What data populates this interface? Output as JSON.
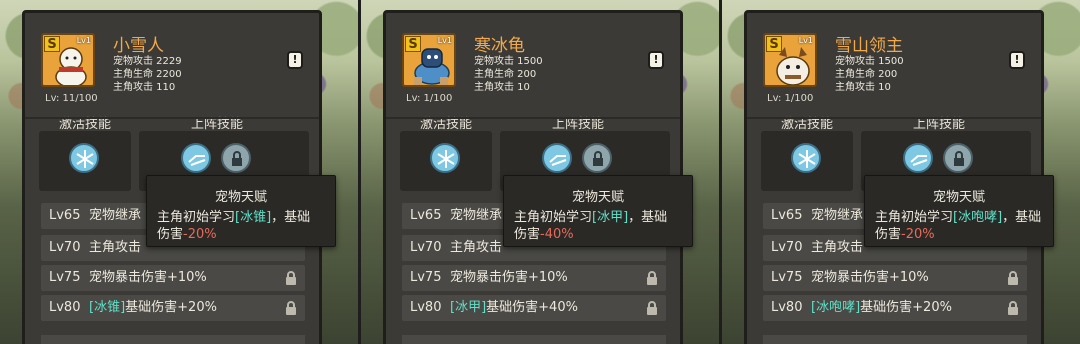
{
  "panels": [
    {
      "name": "小雪人",
      "level_badge": "Lv1",
      "level_line": "Lv: 11/100",
      "grade": "S",
      "stats": [
        "宠物攻击 2229",
        "主角生命 2200",
        "主角攻击 110"
      ],
      "rows": [
        {
          "lv": "Lv65",
          "text": "宠物继承",
          "pre": "",
          "post": ""
        },
        {
          "lv": "Lv70",
          "text": "主角攻击",
          "pre": "",
          "post": ""
        },
        {
          "lv": "Lv75",
          "text": "宠物暴击伤害+10%",
          "pre": "",
          "post": ""
        },
        {
          "lv": "Lv80",
          "text": "",
          "pre": "[冰锥]",
          "post": "基础伤害+20%"
        }
      ],
      "tip": {
        "title": "宠物天赋",
        "line1_a": "主角初始学习",
        "skill": "[冰锥]",
        "line1_b": "，基础",
        "line2_a": "伤害",
        "value": "-20%"
      }
    },
    {
      "name": "寒冰龟",
      "level_badge": "Lv1",
      "level_line": "Lv: 1/100",
      "grade": "S",
      "stats": [
        "宠物攻击 1500",
        "主角生命 200",
        "主角攻击 10"
      ],
      "rows": [
        {
          "lv": "Lv65",
          "text": "宠物继承",
          "pre": "",
          "post": ""
        },
        {
          "lv": "Lv70",
          "text": "主角攻击",
          "pre": "",
          "post": ""
        },
        {
          "lv": "Lv75",
          "text": "宠物暴击伤害+10%",
          "pre": "",
          "post": ""
        },
        {
          "lv": "Lv80",
          "text": "",
          "pre": "[冰甲]",
          "post": "基础伤害+40%"
        }
      ],
      "tip": {
        "title": "宠物天赋",
        "line1_a": "主角初始学习",
        "skill": "[冰甲]",
        "line1_b": "，基础",
        "line2_a": "伤害",
        "value": "-40%"
      }
    },
    {
      "name": "雪山领主",
      "level_badge": "Lv1",
      "level_line": "Lv: 1/100",
      "grade": "S",
      "stats": [
        "宠物攻击 1500",
        "主角生命 200",
        "主角攻击 10"
      ],
      "rows": [
        {
          "lv": "Lv65",
          "text": "宠物继承",
          "pre": "",
          "post": ""
        },
        {
          "lv": "Lv70",
          "text": "主角攻击",
          "pre": "",
          "post": ""
        },
        {
          "lv": "Lv75",
          "text": "宠物暴击伤害+10%",
          "pre": "",
          "post": ""
        },
        {
          "lv": "Lv80",
          "text": "",
          "pre": "[冰咆哮]",
          "post": "基础伤害+20%"
        }
      ],
      "tip": {
        "title": "宠物天赋",
        "line1_a": "主角初始学习",
        "skill": "[冰咆哮]",
        "line1_b": "，基础",
        "line2_a": "伤害",
        "value": "-20%"
      }
    }
  ],
  "labels": {
    "activate": "激活技能",
    "deploy": "上阵技能",
    "alert": "!"
  },
  "colors": {
    "name": "#f2a94b",
    "highlight": "#5fe0c8",
    "negative": "#e86a5a",
    "avatar_bg": "#e9a33a"
  },
  "icons": {
    "activate_skill": "snowflake-icon",
    "deploy_skill_1": "dash-icon",
    "deploy_skill_2": "lock-icon",
    "row_lock": "padlock-icon"
  }
}
